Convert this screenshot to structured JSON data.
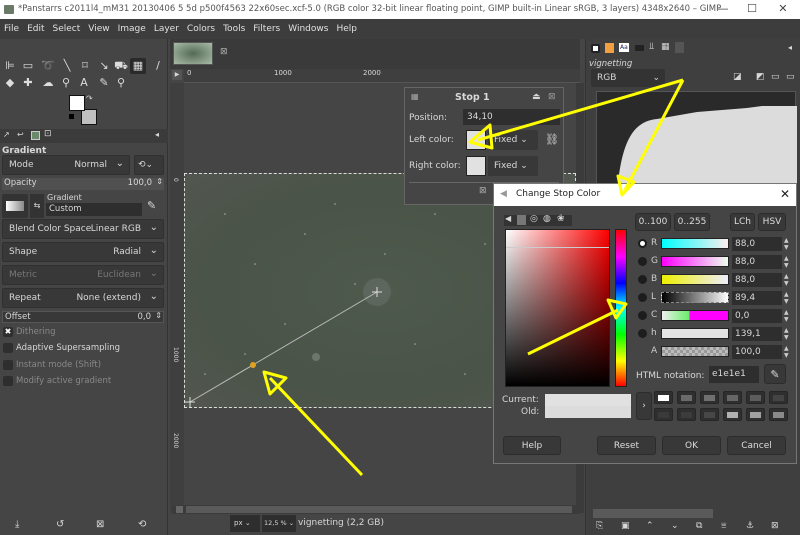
{
  "window": {
    "title": "*Panstarrs c2011l4_mM31 20130406 5 5d p500f4563 22x60sec.xcf-5.0 (RGB color 32-bit linear floating point, GIMP built-in Linear sRGB, 3 layers) 4348x2640 – GIMP",
    "minimize": "—",
    "maximize": "☐",
    "close": "✕"
  },
  "menubar": [
    "File",
    "Edit",
    "Select",
    "View",
    "Image",
    "Layer",
    "Colors",
    "Tools",
    "Filters",
    "Windows",
    "Help"
  ],
  "tool_options": {
    "title": "Gradient",
    "mode_label": "Mode",
    "mode_value": "Normal",
    "opacity_label": "Opacity",
    "opacity_value": "100,0",
    "gradient_label": "Gradient",
    "gradient_name": "Custom",
    "blend_label": "Blend Color Space",
    "blend_value": "Linear RGB",
    "shape_label": "Shape",
    "shape_value": "Radial",
    "metric_label": "Metric",
    "metric_value": "Euclidean",
    "repeat_label": "Repeat",
    "repeat_value": "None (extend)",
    "offset_label": "Offset",
    "offset_value": "0,0",
    "checks": [
      {
        "label": "Dithering",
        "checked": true,
        "enabled": false
      },
      {
        "label": "Adaptive Supersampling",
        "checked": false,
        "enabled": true
      },
      {
        "label": "Instant mode  (Shift)",
        "checked": false,
        "enabled": false
      },
      {
        "label": "Modify active gradient",
        "checked": false,
        "enabled": false
      }
    ]
  },
  "canvas": {
    "ruler_top": [
      "0",
      "1000",
      "2000"
    ],
    "ruler_left": [
      "0",
      "1000",
      "2000"
    ],
    "unit": "px",
    "zoom": "12,5 %",
    "status": "vignetting (2,2 GB)"
  },
  "stop_dialog": {
    "title": "Stop 1",
    "position_label": "Position:",
    "position_value": "34,10",
    "left_color_label": "Left color:",
    "left_mode": "Fixed",
    "right_color_label": "Right color:",
    "right_mode": "Fixed",
    "stop_color": "#e1e1e1"
  },
  "right_dock": {
    "layer_name": "vignetting",
    "channel": "RGB"
  },
  "color_dialog": {
    "title": "Change Stop Color",
    "range_100": "0..100",
    "range_255": "0..255",
    "lch": "LCh",
    "hsv": "HSV",
    "channels": [
      {
        "name": "R",
        "value": "88,0",
        "selected": true
      },
      {
        "name": "G",
        "value": "88,0",
        "selected": false
      },
      {
        "name": "B",
        "value": "88,0",
        "selected": false
      },
      {
        "name": "L",
        "value": "89,4",
        "selected": false
      },
      {
        "name": "C",
        "value": "0,0",
        "selected": false
      },
      {
        "name": "h",
        "value": "139,1",
        "selected": false
      },
      {
        "name": "A",
        "value": "100,0",
        "selected": false
      }
    ],
    "html_label": "HTML notation:",
    "html_value": "e1e1e1",
    "current_label": "Current:",
    "old_label": "Old:",
    "current_color": "#e1e1e1",
    "old_color": "#e1e1e1",
    "history_colors": [
      "#ffffff",
      "#6a6a6a",
      "#707070",
      "#666666",
      "#5c5c5c",
      "#444444",
      "#3a3a3a",
      "#3c3c3c",
      "#474747",
      "#b0b0b0",
      "#a0a0a0",
      "#8a8a8a"
    ],
    "help": "Help",
    "reset": "Reset",
    "ok": "OK",
    "cancel": "Cancel"
  },
  "annotation_color": "#ffff00"
}
